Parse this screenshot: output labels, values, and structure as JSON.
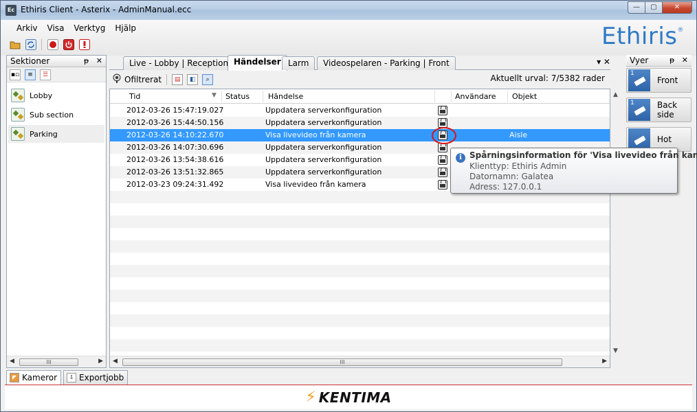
{
  "window": {
    "title": "Ethiris Client - Asterix - AdminManual.ecc",
    "app_icon": "Ec",
    "minimize": "—",
    "maximize": "▢",
    "close": "✕"
  },
  "menu": [
    "Arkiv",
    "Visa",
    "Verktyg",
    "Hjälp"
  ],
  "logo": {
    "text": "Ethiris",
    "mark": "®"
  },
  "left_panel": {
    "title": "Sektioner",
    "pin": "ᵽ",
    "close": "✕",
    "items": [
      {
        "label": "Lobby"
      },
      {
        "label": "Sub section"
      },
      {
        "label": "Parking"
      }
    ],
    "scroll_thumb": "III"
  },
  "tabs": [
    {
      "label": "Live - Lobby | Reception"
    },
    {
      "label": "Händelser"
    },
    {
      "label": "Larm"
    },
    {
      "label": "Videospelaren - Parking | Front"
    }
  ],
  "tab_controls": "▾ ✕",
  "center_toolbar": {
    "filter_label": "Ofiltrerat",
    "selection_status": "Aktuellt urval: 7/5382 rader"
  },
  "grid": {
    "columns": {
      "time": "Tid",
      "status": "Status",
      "event": "Händelse",
      "user": "Användare",
      "object": "Objekt"
    },
    "rows": [
      {
        "time": "2012-03-26 15:47:19.027",
        "event": "Uppdatera serverkonfiguration",
        "object": ""
      },
      {
        "time": "2012-03-26 15:44:50.156",
        "event": "Uppdatera serverkonfiguration",
        "object": ""
      },
      {
        "time": "2012-03-26 14:10:22.670",
        "event": "Visa livevideo från kamera",
        "object": "Aisle"
      },
      {
        "time": "2012-03-26 14:07:30.696",
        "event": "Uppdatera serverkonfiguration",
        "object": ""
      },
      {
        "time": "2012-03-26 13:54:38.616",
        "event": "Uppdatera serverkonfiguration",
        "object": ""
      },
      {
        "time": "2012-03-26 13:51:32.865",
        "event": "Uppdatera serverkonfiguration",
        "object": ""
      },
      {
        "time": "2012-03-23 09:24:31.492",
        "event": "Visa livevideo från kamera",
        "object": ""
      }
    ],
    "selected_row": 2,
    "scroll_thumb": "III"
  },
  "tooltip": {
    "title": "Spårningsinformation för 'Visa livevideo från kamera'",
    "client_type": "Klienttyp: Ethiris Admin",
    "computer_name": "Datornamn: Galatea",
    "address": "Adress: 127.0.0.1"
  },
  "right_panel": {
    "title": "Vyer",
    "pin": "ᵽ",
    "close": "✕",
    "items": [
      {
        "number": "1",
        "label": "Front"
      },
      {
        "number": "1",
        "label": "Back side"
      },
      {
        "number": "",
        "label": "Hot"
      }
    ]
  },
  "bottom_tabs": [
    {
      "label": "Kameror"
    },
    {
      "label": "Exportjobb"
    }
  ],
  "footer": {
    "brand": "KENTIMA",
    "bolt": "⚡"
  },
  "colors": {
    "selection": "#3399ff",
    "logo": "#2f7ac6",
    "highlight_ring": "#d11111"
  }
}
